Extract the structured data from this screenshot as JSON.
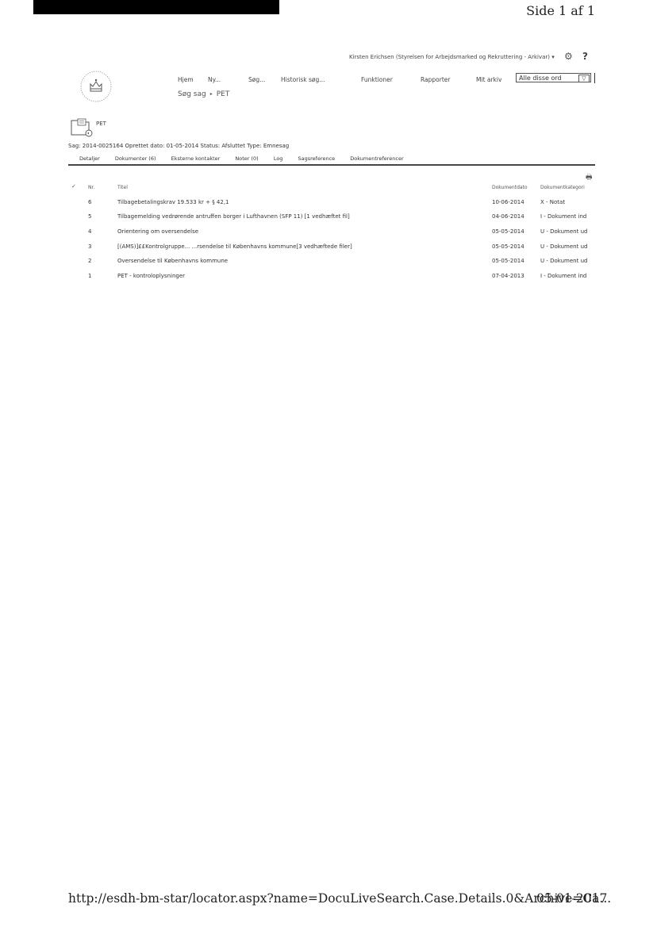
{
  "page": {
    "number_text": "Side 1 af 1",
    "footer_url": "http://esdh-bm-star/locator.aspx?name=DocuLiveSearch.Case.Details.0&Archive=Ca...",
    "footer_date": "05-01-2017"
  },
  "header": {
    "user": "Kirsten Erichsen (Styrelsen for Arbejdsmarked og Rekruttering - Arkivar)",
    "help_label": "?"
  },
  "nav": {
    "items": [
      "Hjem",
      "Ny...",
      "Søg...",
      "Historisk søg...",
      "Funktioner",
      "Rapporter",
      "Mit arkiv"
    ]
  },
  "search": {
    "value": "Alle disse ord"
  },
  "breadcrumb": {
    "root": "Søg sag",
    "current": "PET"
  },
  "case": {
    "label": "PET",
    "meta": "Sag: 2014-0025164  Oprettet dato: 01-05-2014  Status: Afsluttet  Type: Emnesag"
  },
  "tabs": [
    "Detaljer",
    "Dokumenter (6)",
    "Eksterne kontakter",
    "Noter (0)",
    "Log",
    "Sagsreference",
    "Dokumentreferencer"
  ],
  "table": {
    "columns": {
      "nr": "Nr.",
      "title": "Titel",
      "date": "Dokumentdato",
      "category": "Dokumentkategori"
    },
    "rows": [
      {
        "nr": "6",
        "title": "Tilbagebetalingskrav 19.533 kr + § 42,1",
        "date": "10-06-2014",
        "category": "X - Notat"
      },
      {
        "nr": "5",
        "title": "Tilbagemelding vedrørende antruffen borger i Lufthavnen (SFP                    11) [1 vedhæftet fil]",
        "date": "04-06-2014",
        "category": "I - Dokument ind"
      },
      {
        "nr": "4",
        "title": "Orientering om oversendelse",
        "date": "05-05-2014",
        "category": "U - Dokument ud"
      },
      {
        "nr": "3",
        "title": "[(AMS)]££Kontrolgruppe...                              ...rsendelse til Københavns kommune[3 vedhæftede filer]",
        "date": "05-05-2014",
        "category": "U - Dokument ud"
      },
      {
        "nr": "2",
        "title": "Oversendelse til Københavns kommune",
        "date": "05-05-2014",
        "category": "U - Dokument ud"
      },
      {
        "nr": "1",
        "title": "PET - kontroloplysninger",
        "date": "07-04-2013",
        "category": "I - Dokument ind"
      }
    ]
  }
}
